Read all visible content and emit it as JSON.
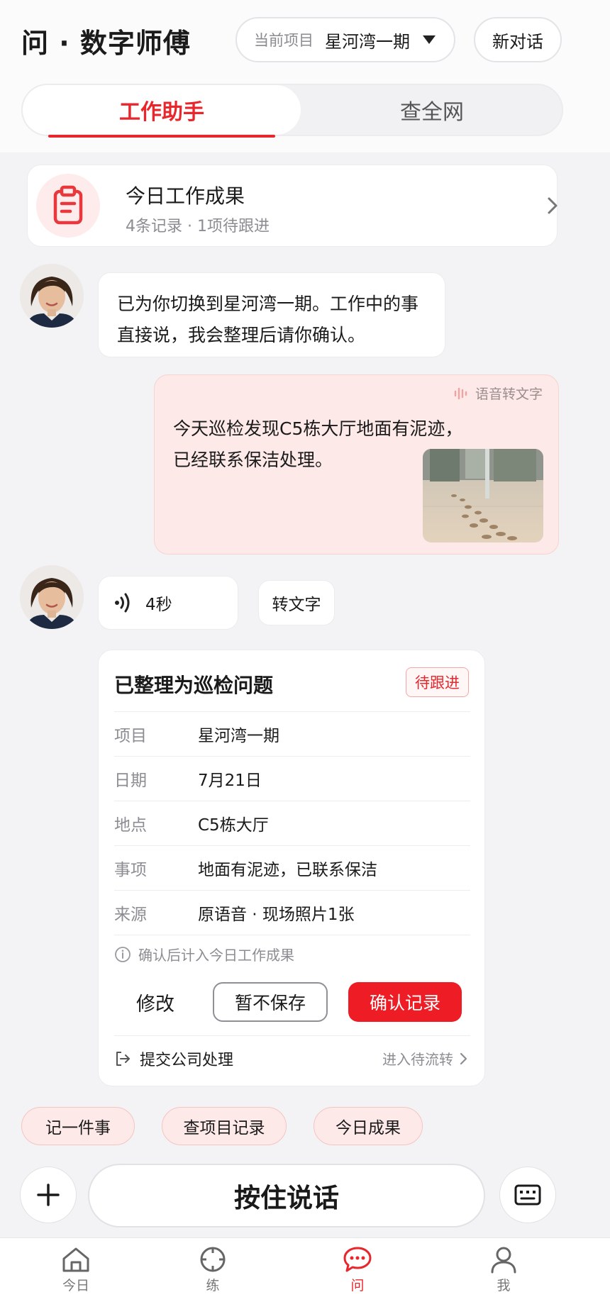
{
  "header": {
    "app_title": "问 · 数字师傅",
    "project_label": "当前项目",
    "project_value": "星河湾一期",
    "new_chat": "新对话",
    "tabs": [
      {
        "label": "工作助手",
        "active": true
      },
      {
        "label": "查全网",
        "active": false
      }
    ]
  },
  "summary": {
    "icon": "clipboard-icon",
    "title": "今日工作成果",
    "subtitle": "4条记录 · 1项待跟进"
  },
  "messages": {
    "assistant_greeting": [
      "已为你切换到星河湾一期。工作中的事",
      "直接说，我会整理后请你确认。"
    ],
    "user_tag": "语音转文字",
    "user_text": [
      "今天巡检发现C5栋大厅地面有泥迹，",
      "已经联系保洁处理。"
    ],
    "audio_duration": "4秒",
    "to_text_button": "转文字"
  },
  "record_card": {
    "title": "已整理为巡检问题",
    "status": "待跟进",
    "rows": [
      {
        "key": "项目",
        "value": "星河湾一期"
      },
      {
        "key": "日期",
        "value": "7月21日"
      },
      {
        "key": "地点",
        "value": "C5栋大厅"
      },
      {
        "key": "事项",
        "value": "地面有泥迹，已联系保洁"
      },
      {
        "key": "来源",
        "value": "原语音 · 现场照片1张"
      }
    ],
    "note": "确认后计入今日工作成果",
    "edit": "修改",
    "skip": "暂不保存",
    "confirm": "确认记录",
    "submit_label": "提交公司处理",
    "submit_right": "进入待流转"
  },
  "chips": [
    "记一件事",
    "查项目记录",
    "今日成果"
  ],
  "input_bar": {
    "talk": "按住说话"
  },
  "tabbar": [
    {
      "label": "今日",
      "icon": "home-icon",
      "active": false
    },
    {
      "label": "练",
      "icon": "target-icon",
      "active": false
    },
    {
      "label": "问",
      "icon": "chat-icon",
      "active": true
    },
    {
      "label": "我",
      "icon": "user-icon",
      "active": false
    }
  ],
  "colors": {
    "accent": "#e8262b",
    "accent_soft": "#fde9e8",
    "background": "#f3f3f5"
  }
}
